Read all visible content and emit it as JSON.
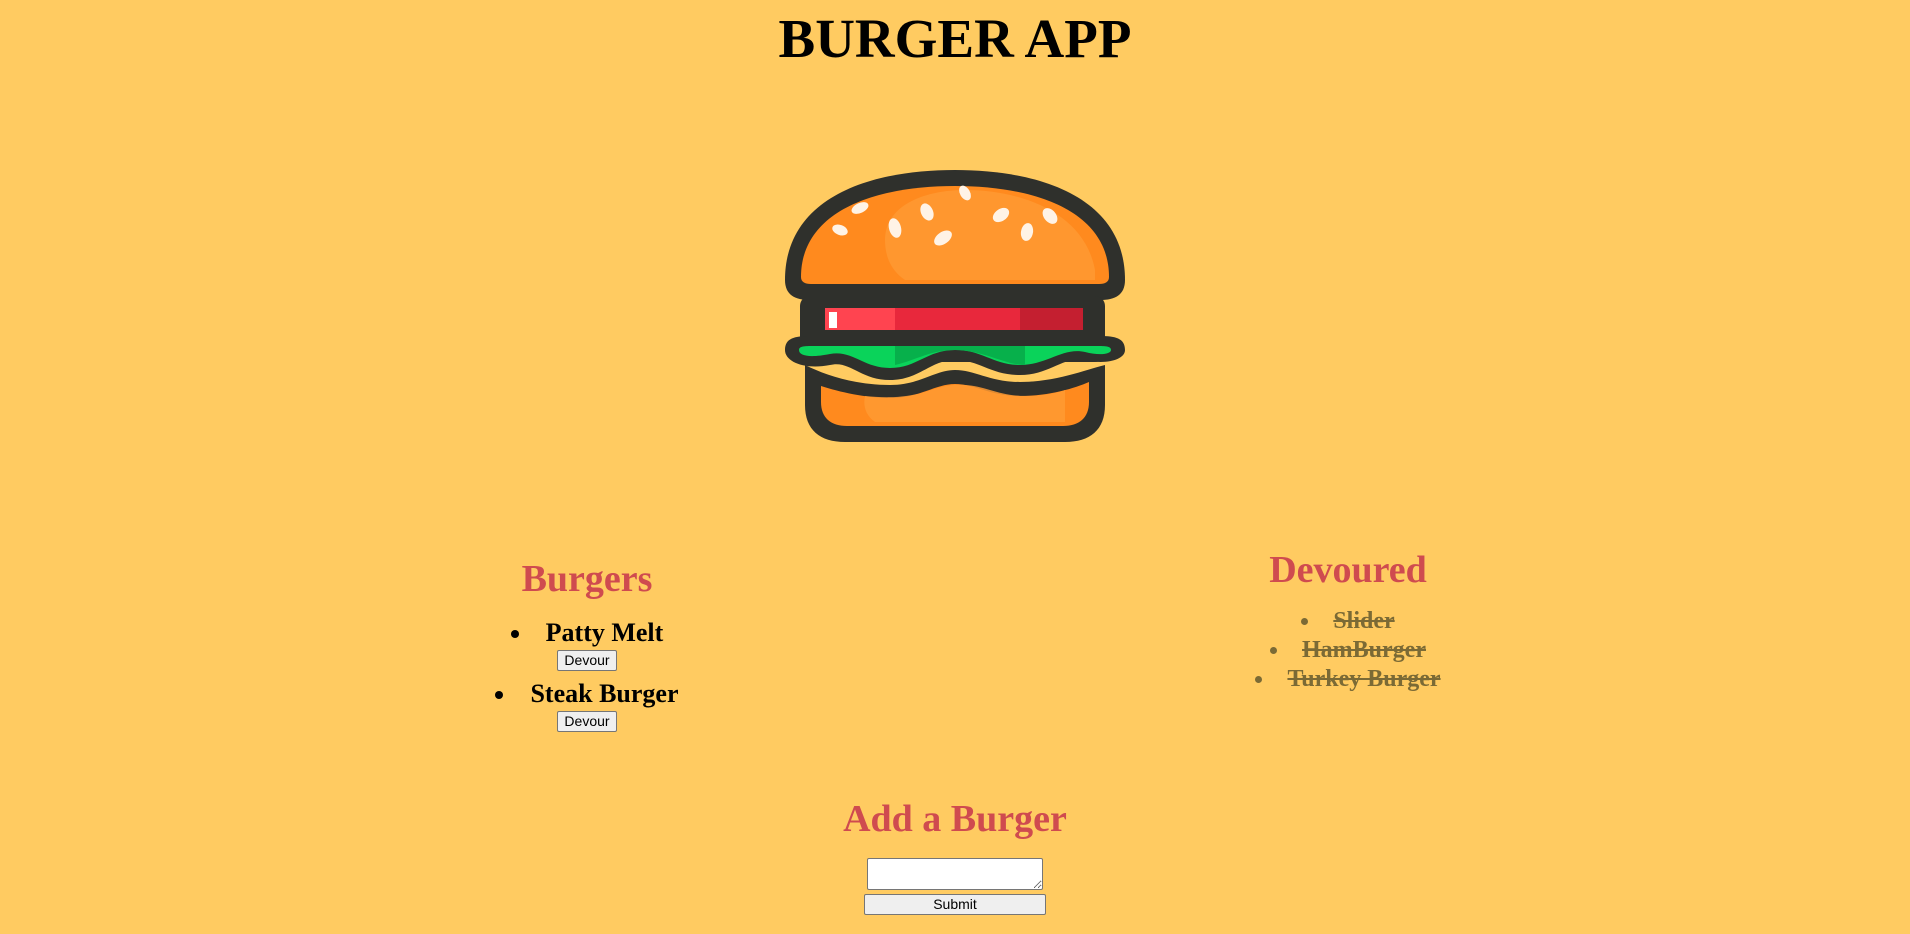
{
  "header": {
    "title": "BURGER APP"
  },
  "logo": {
    "icon": "burger-icon"
  },
  "burgers": {
    "heading": "Burgers",
    "items": [
      {
        "name": "Patty Melt",
        "button_label": "Devour"
      },
      {
        "name": "Steak Burger",
        "button_label": "Devour"
      }
    ]
  },
  "devoured": {
    "heading": "Devoured",
    "items": [
      "Slider",
      "HamBurger",
      "Turkey Burger"
    ]
  },
  "add_burger": {
    "heading": "Add a Burger",
    "input_value": "",
    "submit_label": "Submit"
  },
  "colors": {
    "background": "#ffcb61",
    "heading_accent": "#cf4b4f",
    "devoured_text": "#7b6a35"
  }
}
